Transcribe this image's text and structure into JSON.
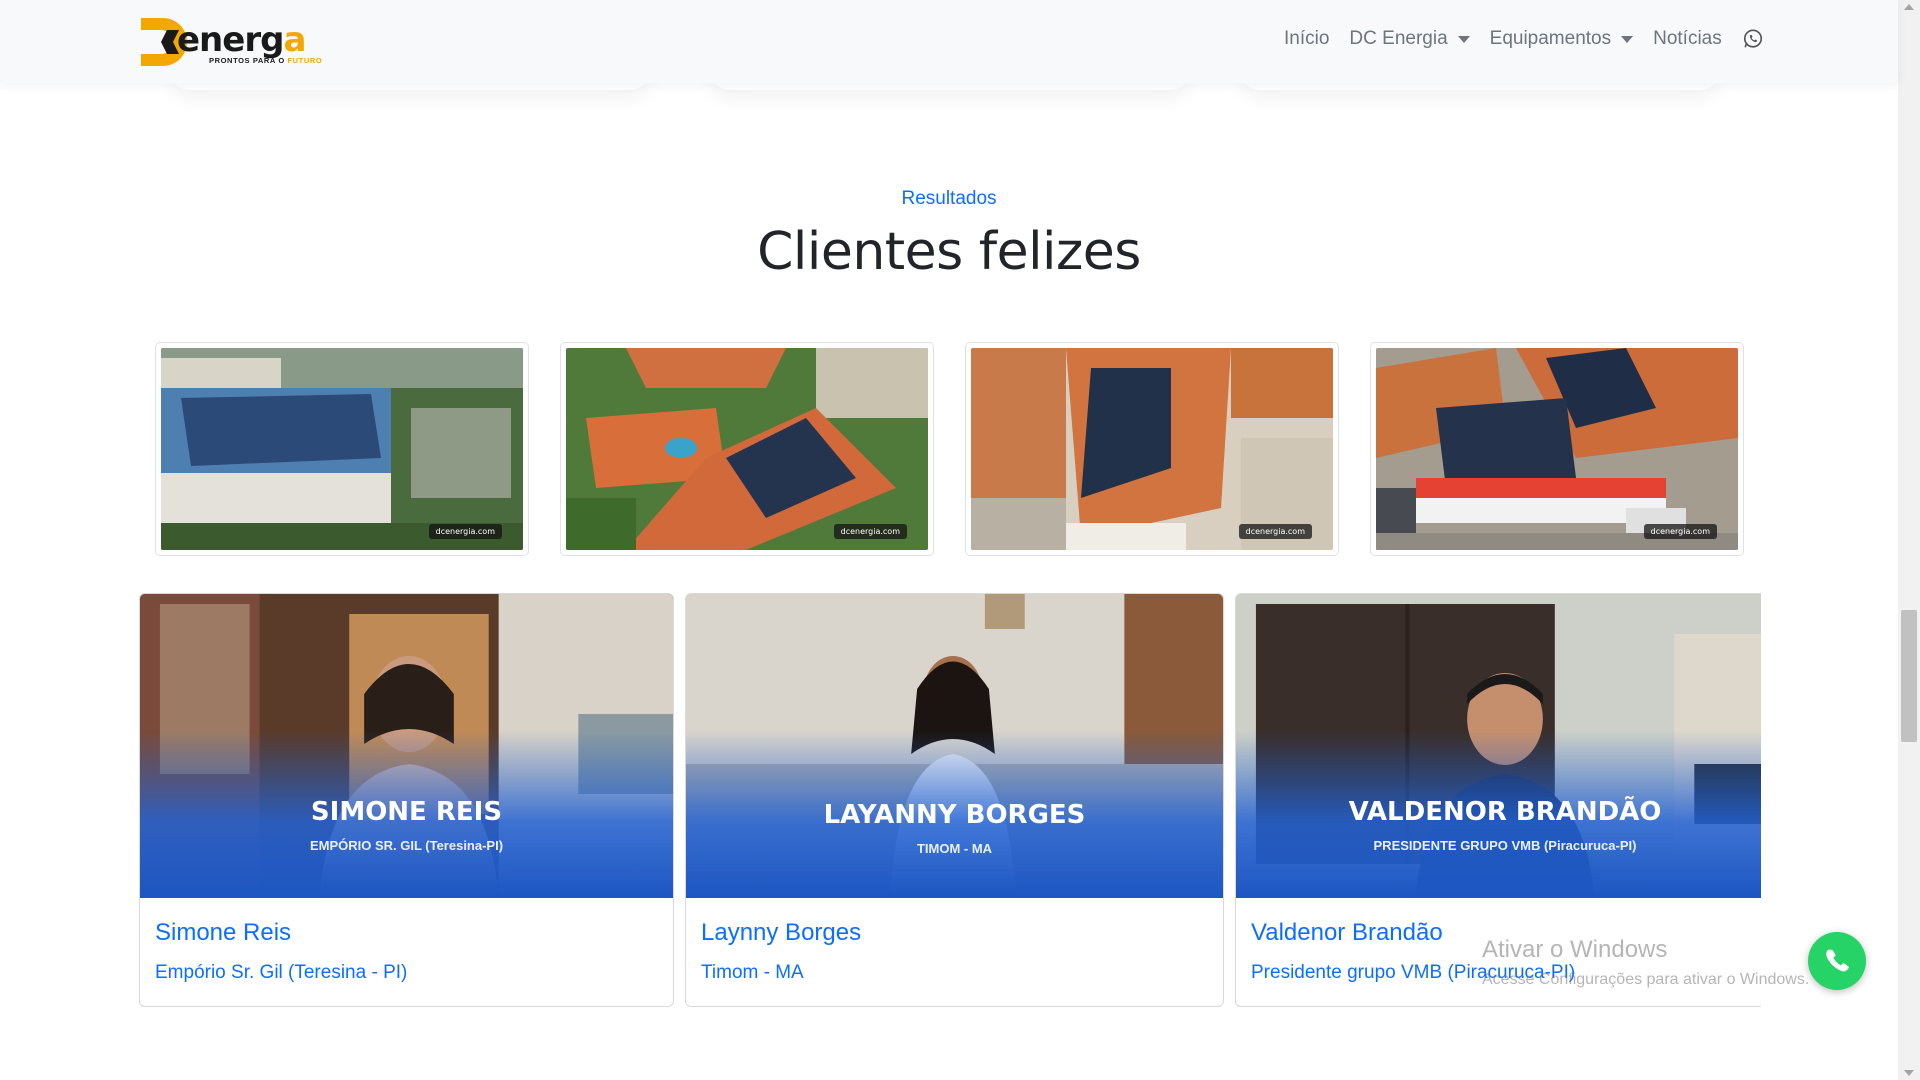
{
  "brand": {
    "logo_word": "energ",
    "logo_word_end": "a",
    "logo_tagline": "PRONTOS PARA O",
    "logo_tagline_accent": "FUTURO",
    "accent_color": "#f2a800"
  },
  "nav": {
    "items": [
      {
        "label": "Início",
        "dropdown": false
      },
      {
        "label": "DC Energia",
        "dropdown": true
      },
      {
        "label": "Equipamentos",
        "dropdown": true
      },
      {
        "label": "Notícias",
        "dropdown": false
      }
    ],
    "whatsapp_icon": "whatsapp-icon"
  },
  "section": {
    "subtitle": "Resultados",
    "title": "Clientes felizes"
  },
  "gallery": {
    "watermark": "dcenergia.com",
    "photos": [
      "photo-1",
      "photo-2",
      "photo-3",
      "photo-4"
    ]
  },
  "testimonials": [
    {
      "overlay_name": "SIMONE REIS",
      "overlay_sub": "EMPÓRIO SR. GIL (Teresina-PI)",
      "name": "Simone Reis",
      "company": "Empório Sr. Gil (Teresina - PI)"
    },
    {
      "overlay_name": "LAYANNY BORGES",
      "overlay_sub": "TIMOM - MA",
      "name": "Laynny Borges",
      "company": "Timom - MA"
    },
    {
      "overlay_name": "VALDENOR BRANDÃO",
      "overlay_sub": "PRESIDENTE GRUPO VMB (Piracuruca-PI)",
      "name": "Valdenor Brandão",
      "company": "Presidente grupo VMB (Piracuruca-PI)"
    }
  ],
  "windows_watermark": {
    "line1": "Ativar o Windows",
    "line2": "Acesse Configurações para ativar o Windows."
  },
  "floating": {
    "icon": "whatsapp-icon",
    "color": "#25d366"
  }
}
